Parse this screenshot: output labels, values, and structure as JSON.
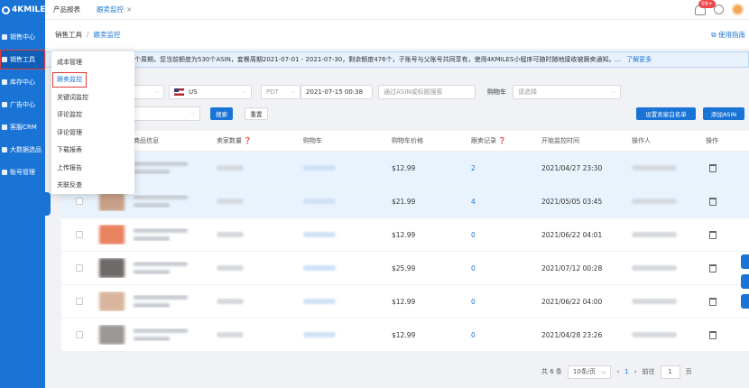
{
  "app": {
    "logo": "4KMILES"
  },
  "sidebar": {
    "items": [
      {
        "label": "销售中心",
        "active": false
      },
      {
        "label": "销售工具",
        "active": true
      },
      {
        "label": "库存中心",
        "active": false
      },
      {
        "label": "广告中心",
        "active": false
      },
      {
        "label": "客服CRM",
        "active": false
      },
      {
        "label": "大数据选品",
        "active": false
      },
      {
        "label": "账号管理",
        "active": false
      }
    ]
  },
  "tabs": [
    {
      "label": "产品报表"
    },
    {
      "label": "跟卖监控",
      "close": "×"
    }
  ],
  "header": {
    "badge": "99+"
  },
  "breadcrumb": {
    "root": "销售工具",
    "sep": "/",
    "current": "跟卖监控",
    "help": "使用指南"
  },
  "notice": {
    "text": "个周期，您当前额度为530个ASIN，套餐周期2021-07-01 - 2021-07-30，剩余额度476个，子账号与父账号共同享有，使用4KMILES小程序可随时随地接收被跟卖通知。...",
    "link": "了解更多"
  },
  "filters": {
    "marketplace": "US",
    "timezone": "PDT",
    "datetime": "2021-07-15 00:38",
    "search_placeholder": "通过ASIN或标题搜索",
    "cart_label": "购物车",
    "cart_placeholder": "请选择",
    "search_button": "搜索",
    "reset_button": "重置",
    "set_seller_button": "设置卖家白名单",
    "add_asin_button": "添加ASIN"
  },
  "table": {
    "headers": {
      "product": "商品信息",
      "sellers": "卖家数量",
      "cart": "购物车",
      "price": "购物车价格",
      "records": "跟卖记录",
      "start": "开始监控时间",
      "operator": "操作人",
      "action": "操作"
    },
    "rows": [
      {
        "price": "$12.99",
        "records": "2",
        "start": "2021/04/27 23:30",
        "thumb": "#b6a79a"
      },
      {
        "price": "$21.99",
        "records": "4",
        "start": "2021/05/05 03:45",
        "thumb": "#c9a089"
      },
      {
        "price": "$12.99",
        "records": "0",
        "start": "2021/06/22 04:01",
        "thumb": "#e8825f"
      },
      {
        "price": "$25.99",
        "records": "0",
        "start": "2021/07/12 00:28",
        "thumb": "#6d6a68"
      },
      {
        "price": "$12.99",
        "records": "0",
        "start": "2021/06/22 04:00",
        "thumb": "#d9b59d"
      },
      {
        "price": "$12.99",
        "records": "0",
        "start": "2021/04/28 23:26",
        "thumb": "#9a9794"
      }
    ]
  },
  "pagination": {
    "total": "共 6 条",
    "page_size": "10条/页",
    "prev": "‹",
    "current": "1",
    "next": "›",
    "goto": "前往",
    "page_input": "1",
    "page_suffix": "页"
  },
  "dropdown": {
    "items": [
      {
        "label": "成本管理",
        "active": false
      },
      {
        "label": "跟卖监控",
        "active": true
      },
      {
        "label": "关键词监控",
        "active": false
      },
      {
        "label": "评论监控",
        "active": false
      },
      {
        "label": "评论管理",
        "active": false
      },
      {
        "label": "下载报表",
        "active": false
      },
      {
        "label": "上传报告",
        "active": false
      },
      {
        "label": "关联反查",
        "active": false
      }
    ]
  }
}
